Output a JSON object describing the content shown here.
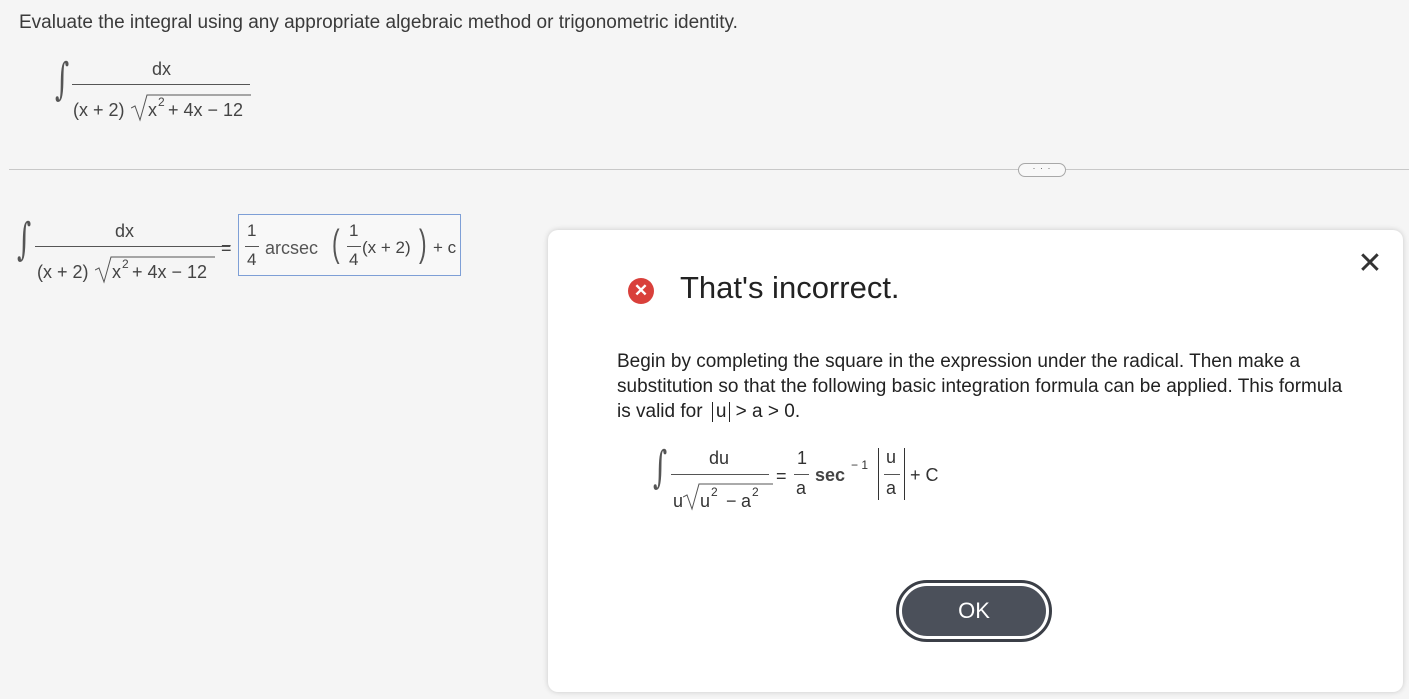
{
  "problem": {
    "instruction": "Evaluate the integral using any appropriate algebraic method or trigonometric identity.",
    "integral": {
      "numerator": "dx",
      "den_prefix": "(x + 2)",
      "den_radicand": "x",
      "den_exp": "2",
      "den_rest": "+ 4x − 12"
    }
  },
  "more_button": "· · ·",
  "answer_row": {
    "equals": "=",
    "coef_num": "1",
    "coef_den": "4",
    "func": "arcsec",
    "inner_num": "1",
    "inner_den": "4",
    "inner_arg": "(x + 2)",
    "constant": "+ c"
  },
  "dialog": {
    "status_title": "That's incorrect.",
    "feedback_text": "Begin by completing the square in the expression under the radical. Then make a substitution so that the following basic integration formula can be applied. This formula is valid for",
    "condition_u": "u",
    "condition_rest": "> a > 0.",
    "formula": {
      "numerator": "du",
      "den_u": "u",
      "den_radicand_u": "u",
      "exp1": "2",
      "minus": "−",
      "den_radicand_a": "a",
      "exp2": "2",
      "equals": "=",
      "coef_num": "1",
      "coef_den": "a",
      "func": "sec",
      "inv_exp": "− 1",
      "abs_num": "u",
      "abs_den": "a",
      "constant": "+ C"
    },
    "ok_label": "OK",
    "close_symbol": "✕"
  },
  "colors": {
    "error": "#d9403b",
    "answer_border": "#7e9fd6",
    "ok_button": "#4b505a"
  }
}
